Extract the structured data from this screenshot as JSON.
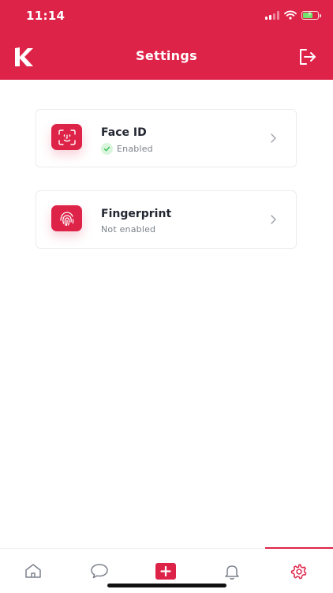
{
  "status_bar": {
    "time": "11:14"
  },
  "header": {
    "title": "Settings",
    "logo_icon": "k-logo-icon",
    "logout_icon": "logout-icon"
  },
  "settings": [
    {
      "title": "Face ID",
      "status": "Enabled",
      "enabled": true,
      "icon": "face-id-icon"
    },
    {
      "title": "Fingerprint",
      "status": "Not enabled",
      "enabled": false,
      "icon": "fingerprint-icon"
    }
  ],
  "bottom_nav": {
    "items": [
      {
        "icon": "home-icon"
      },
      {
        "icon": "chat-icon"
      },
      {
        "icon": "add-icon"
      },
      {
        "icon": "bell-icon"
      },
      {
        "icon": "gear-icon",
        "active": true
      }
    ]
  },
  "colors": {
    "brand": "#DE2349",
    "enabled_badge": "#D9F6DC",
    "enabled_check": "#3DBE5A",
    "nav_icon": "#7C818B"
  }
}
